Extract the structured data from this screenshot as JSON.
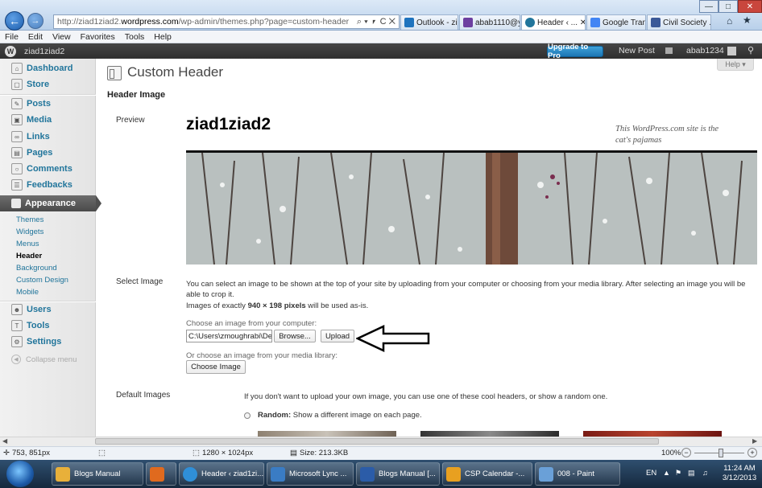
{
  "browser": {
    "address_prefix": "http://ziad1ziad2.",
    "address_host": "wordpress.com",
    "address_path": "/wp-admin/themes.php?page=custom-header",
    "address_tools": "⌕ ▾ ⎖ C ✕",
    "tabs": [
      {
        "label": "Outlook - zi...",
        "color": "#1e73be"
      },
      {
        "label": "abab1110@y...",
        "color": "#6d3fa0"
      },
      {
        "label": "Header ‹ ... ✕",
        "color": "#21759b"
      },
      {
        "label": "Google Tran...",
        "color": "#4285f4"
      },
      {
        "label": "Civil Society ...",
        "color": "#3b5998"
      }
    ],
    "menu": [
      "File",
      "Edit",
      "View",
      "Favorites",
      "Tools",
      "Help"
    ]
  },
  "adminbar": {
    "site": "ziad1ziad2",
    "upgrade": "Upgrade to Pro",
    "new_post": "New Post",
    "user": "abab1234"
  },
  "sidebar": {
    "items": [
      {
        "label": "Dashboard",
        "icon": "dashboard-icon"
      },
      {
        "label": "Store",
        "icon": "store-icon"
      },
      {
        "label": "Posts",
        "icon": "posts-icon"
      },
      {
        "label": "Media",
        "icon": "media-icon"
      },
      {
        "label": "Links",
        "icon": "links-icon"
      },
      {
        "label": "Pages",
        "icon": "pages-icon"
      },
      {
        "label": "Comments",
        "icon": "comments-icon"
      },
      {
        "label": "Feedbacks",
        "icon": "feedbacks-icon"
      }
    ],
    "appearance": "Appearance",
    "sub": [
      "Themes",
      "Widgets",
      "Menus",
      "Header",
      "Background",
      "Custom Design",
      "Mobile"
    ],
    "lower": [
      {
        "label": "Users",
        "icon": "users-icon"
      },
      {
        "label": "Tools",
        "icon": "tools-icon"
      },
      {
        "label": "Settings",
        "icon": "settings-icon"
      }
    ],
    "collapse": "Collapse menu"
  },
  "main": {
    "title": "Custom Header",
    "help": "Help ▾",
    "section": "Header Image",
    "preview_label": "Preview",
    "site_name": "ziad1ziad2",
    "tagline": "This WordPress.com site is the cat's pajamas",
    "select_label": "Select Image",
    "select_desc1": "You can select an image to be shown at the top of your site by uploading from your computer or choosing from your media library. After selecting an image you will be able to crop it.",
    "select_desc2_pre": "Images of exactly ",
    "select_desc2_bold": "940 × 198 pixels",
    "select_desc2_post": " will be used as-is.",
    "choose_computer": "Choose an image from your computer:",
    "file_value": "C:\\Users\\zmoughrabi\\Des",
    "browse": "Browse...",
    "upload": "Upload",
    "choose_library": "Or choose an image from your media library:",
    "choose_image": "Choose Image",
    "default_label": "Default Images",
    "default_desc": "If you don't want to upload your own image, you can use one of these cool headers, or show a random one.",
    "random_bold": "Random:",
    "random_desc": " Show a different image on each page."
  },
  "status": {
    "coords": "753, 851px",
    "dims": "1280 × 1024px",
    "size": "Size: 213.3KB",
    "zoom": "100%"
  },
  "taskbar": {
    "items": [
      {
        "label": "Blogs Manual",
        "color": "#e8b03a"
      },
      {
        "label": "",
        "color": "#e06a1e"
      },
      {
        "label": "Header ‹ ziad1zi...",
        "color": "#2f8fd8"
      },
      {
        "label": "Microsoft Lync ...",
        "color": "#3a7cc4"
      },
      {
        "label": "Blogs Manual [...",
        "color": "#2b5ca8"
      },
      {
        "label": "CSP Calendar -...",
        "color": "#e8a020"
      },
      {
        "label": "008 - Paint",
        "color": "#6aa0d8"
      }
    ],
    "lang": "EN",
    "time": "11:24 AM",
    "date": "3/12/2013"
  }
}
